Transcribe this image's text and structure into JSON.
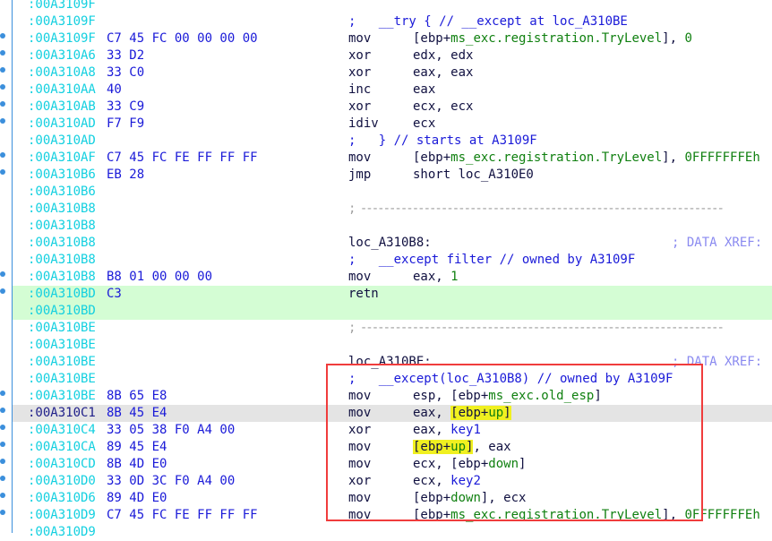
{
  "view": "IDA disassembly listing",
  "colors": {
    "address": "#14d0e0",
    "bytes": "#1a1ad8",
    "name": "#108010",
    "comment": "#1a1ad8",
    "highlight": "#f0f020",
    "executed_band": "#d4fdd4",
    "current_line": "#e4e4e4",
    "annotation_box": "#f03c3c"
  },
  "rows": [
    {
      "addr": ":00A3109F",
      "bytes": "",
      "mnem": "",
      "op": []
    },
    {
      "addr": ":00A3109F",
      "bytes": "",
      "full": [
        [
          ";   __try { // __except at loc_A310BE",
          "c"
        ]
      ]
    },
    {
      "addr": ":00A3109F",
      "bytes": "C7 45 FC 00 00 00 00",
      "mnem": "mov",
      "op": [
        [
          "[ebp+",
          "n"
        ],
        [
          "ms_exc.registration.TryLevel",
          "g"
        ],
        [
          "], ",
          "n"
        ],
        [
          "0",
          "g"
        ]
      ],
      "dot": true
    },
    {
      "addr": ":00A310A6",
      "bytes": "33 D2",
      "mnem": "xor",
      "op": [
        [
          "edx, edx",
          "n"
        ]
      ],
      "dot": true
    },
    {
      "addr": ":00A310A8",
      "bytes": "33 C0",
      "mnem": "xor",
      "op": [
        [
          "eax, eax",
          "n"
        ]
      ],
      "dot": true
    },
    {
      "addr": ":00A310AA",
      "bytes": "40",
      "mnem": "inc",
      "op": [
        [
          "eax",
          "n"
        ]
      ],
      "dot": true
    },
    {
      "addr": ":00A310AB",
      "bytes": "33 C9",
      "mnem": "xor",
      "op": [
        [
          "ecx, ecx",
          "n"
        ]
      ],
      "dot": true
    },
    {
      "addr": ":00A310AD",
      "bytes": "F7 F9",
      "mnem": "idiv",
      "op": [
        [
          "ecx",
          "n"
        ]
      ],
      "dot": true
    },
    {
      "addr": ":00A310AD",
      "bytes": "",
      "full": [
        [
          ";   } // starts at A3109F",
          "c"
        ]
      ]
    },
    {
      "addr": ":00A310AF",
      "bytes": "C7 45 FC FE FF FF FF",
      "mnem": "mov",
      "op": [
        [
          "[ebp+",
          "n"
        ],
        [
          "ms_exc.registration.TryLevel",
          "g"
        ],
        [
          "], ",
          "n"
        ],
        [
          "0FFFFFFFEh",
          "g"
        ]
      ],
      "dot": true
    },
    {
      "addr": ":00A310B6",
      "bytes": "EB 28",
      "mnem": "jmp",
      "op": [
        [
          "short loc_A310E0",
          "n"
        ]
      ],
      "dot": true
    },
    {
      "addr": ":00A310B6",
      "bytes": ""
    },
    {
      "addr": ":00A310B8",
      "bytes": "",
      "full": [
        [
          "; ---------------------------------------------------------------",
          "sep"
        ]
      ]
    },
    {
      "addr": ":00A310B8",
      "bytes": ""
    },
    {
      "addr": ":00A310B8",
      "bytes": "",
      "full": [
        [
          "loc_A310B8:",
          "n"
        ]
      ],
      "xref": "; DATA XREF:"
    },
    {
      "addr": ":00A310B8",
      "bytes": "",
      "full": [
        [
          ";   __except filter // owned by A3109F",
          "c"
        ]
      ]
    },
    {
      "addr": ":00A310B8",
      "bytes": "B8 01 00 00 00",
      "mnem": "mov",
      "op": [
        [
          "eax, ",
          "n"
        ],
        [
          "1",
          "g"
        ]
      ],
      "dot": true
    },
    {
      "addr": ":00A310BD",
      "bytes": "C3",
      "mnem": "retn",
      "op": [],
      "dot": true,
      "band": "green"
    },
    {
      "addr": ":00A310BD",
      "bytes": "",
      "band": "green"
    },
    {
      "addr": ":00A310BE",
      "bytes": "",
      "full": [
        [
          "; ---------------------------------------------------------------",
          "sep"
        ]
      ]
    },
    {
      "addr": ":00A310BE",
      "bytes": ""
    },
    {
      "addr": ":00A310BE",
      "bytes": "",
      "full": [
        [
          "loc_A310BE:",
          "n"
        ]
      ],
      "xref": "; DATA XREF:"
    },
    {
      "addr": ":00A310BE",
      "bytes": "",
      "full": [
        [
          ";   __except(loc_A310B8) // owned by A3109F",
          "c"
        ]
      ]
    },
    {
      "addr": ":00A310BE",
      "bytes": "8B 65 E8",
      "mnem": "mov",
      "op": [
        [
          "esp, [ebp+",
          "n"
        ],
        [
          "ms_exc.old_esp",
          "g"
        ],
        [
          "]",
          "n"
        ]
      ],
      "dot": true
    },
    {
      "addr": ":00A310C1",
      "bytes": "8B 45 E4",
      "mnem": "mov",
      "op": [
        [
          "eax, ",
          "n"
        ],
        [
          "[ebp+",
          "ny"
        ],
        [
          "up",
          "gy"
        ],
        [
          "]",
          "ny"
        ]
      ],
      "dot": true,
      "band": "cur"
    },
    {
      "addr": ":00A310C4",
      "bytes": "33 05 38 F0 A4 00",
      "mnem": "xor",
      "op": [
        [
          "eax, ",
          "n"
        ],
        [
          "key1",
          "b"
        ]
      ],
      "dot": true
    },
    {
      "addr": ":00A310CA",
      "bytes": "89 45 E4",
      "mnem": "mov",
      "op": [
        [
          "[ebp+",
          "ny"
        ],
        [
          "up",
          "gy"
        ],
        [
          "]",
          "ny"
        ],
        [
          ", eax",
          "n"
        ]
      ],
      "dot": true
    },
    {
      "addr": ":00A310CD",
      "bytes": "8B 4D E0",
      "mnem": "mov",
      "op": [
        [
          "ecx, [ebp+",
          "n"
        ],
        [
          "down",
          "g"
        ],
        [
          "]",
          "n"
        ]
      ],
      "dot": true
    },
    {
      "addr": ":00A310D0",
      "bytes": "33 0D 3C F0 A4 00",
      "mnem": "xor",
      "op": [
        [
          "ecx, ",
          "n"
        ],
        [
          "key2",
          "b"
        ]
      ],
      "dot": true
    },
    {
      "addr": ":00A310D6",
      "bytes": "89 4D E0",
      "mnem": "mov",
      "op": [
        [
          "[ebp+",
          "n"
        ],
        [
          "down",
          "g"
        ],
        [
          "], ecx",
          "n"
        ]
      ],
      "dot": true
    },
    {
      "addr": ":00A310D9",
      "bytes": "C7 45 FC FE FF FF FF",
      "mnem": "mov",
      "op": [
        [
          "[ebp+",
          "n"
        ],
        [
          "ms_exc.registration.TryLevel",
          "g"
        ],
        [
          "], ",
          "n"
        ],
        [
          "0FFFFFFFEh",
          "g"
        ]
      ],
      "dot": true
    },
    {
      "addr": ":00A310D9",
      "bytes": ""
    }
  ]
}
